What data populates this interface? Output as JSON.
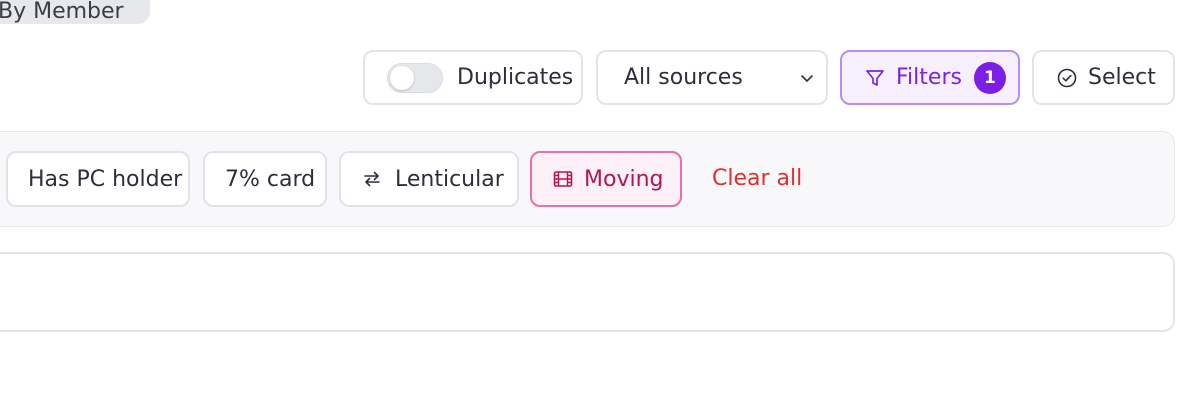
{
  "top_tab": {
    "label": "By Member"
  },
  "toolbar": {
    "duplicates_label": "Duplicates",
    "duplicates_on": false,
    "sources_selected": "All sources",
    "filters_label": "Filters",
    "filters_count": "1",
    "select_label": "Select"
  },
  "chips": {
    "pc_holder": "Has PC holder",
    "seven_card": "7% card",
    "lenticular": "Lenticular",
    "moving": "Moving",
    "clear_all": "Clear all"
  },
  "icons": {
    "dropdown": "chevron-down-icon",
    "filters": "funnel-icon",
    "select": "check-circle-icon",
    "lenticular": "swap-arrows-icon",
    "moving": "film-icon"
  },
  "colors": {
    "filters_accent": "#7c1fe6",
    "moving_accent": "#e86fa8",
    "clear_all": "#e0302e"
  }
}
